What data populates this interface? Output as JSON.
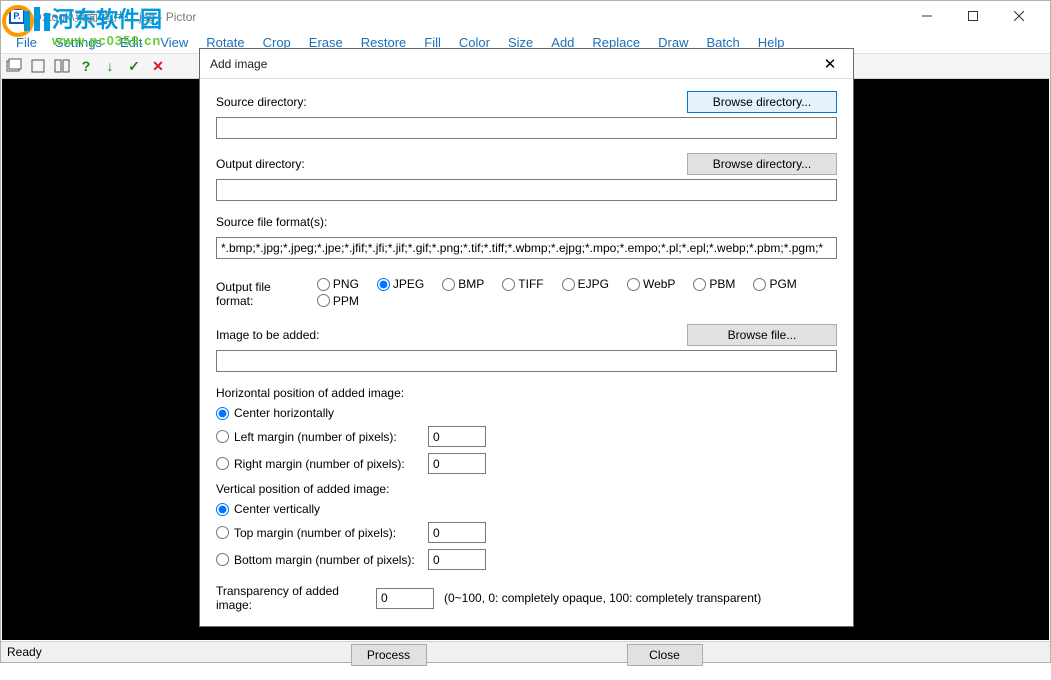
{
  "main": {
    "title": "D:\\took\\桌面\\图片\\1.jpg - Pictor",
    "menus": [
      "File",
      "Settings",
      "Edit",
      "View",
      "Rotate",
      "Crop",
      "Erase",
      "Restore",
      "Fill",
      "Color",
      "Size",
      "Add",
      "Replace",
      "Draw",
      "Batch",
      "Help"
    ],
    "status": "Ready"
  },
  "watermark": {
    "cn": "河东软件园",
    "url": "www.pc0359.cn"
  },
  "dialog": {
    "title": "Add image",
    "source_label": "Source directory:",
    "browse_dir": "Browse directory...",
    "source_value": "",
    "output_label": "Output directory:",
    "output_value": "",
    "formats_label": "Source file format(s):",
    "formats_value": "*.bmp;*.jpg;*.jpeg;*.jpe;*.jfif;*.jfi;*.jif;*.gif;*.png;*.tif;*.tiff;*.wbmp;*.ejpg;*.mpo;*.empo;*.pl;*.epl;*.webp;*.pbm;*.pgm;*",
    "outfmt_label": "Output file format:",
    "outfmt_opts": [
      "PNG",
      "JPEG",
      "BMP",
      "TIFF",
      "EJPG",
      "WebP",
      "PBM",
      "PGM",
      "PPM"
    ],
    "outfmt_selected": "JPEG",
    "imgadd_label": "Image to be added:",
    "browse_file": "Browse file...",
    "imgadd_value": "",
    "hpos_label": "Horizontal position of added image:",
    "hpos_opts": {
      "center": "Center horizontally",
      "left": "Left margin (number of pixels):",
      "right": "Right margin (number of pixels):"
    },
    "hpos_selected": "center",
    "left_val": "0",
    "right_val": "0",
    "vpos_label": "Vertical position of added image:",
    "vpos_opts": {
      "center": "Center vertically",
      "top": "Top margin (number of pixels):",
      "bottom": "Bottom margin (number of pixels):"
    },
    "vpos_selected": "center",
    "top_val": "0",
    "bottom_val": "0",
    "trans_label": "Transparency of added image:",
    "trans_val": "0",
    "trans_hint": "(0~100, 0: completely opaque, 100: completely transparent)",
    "process": "Process",
    "close": "Close"
  }
}
